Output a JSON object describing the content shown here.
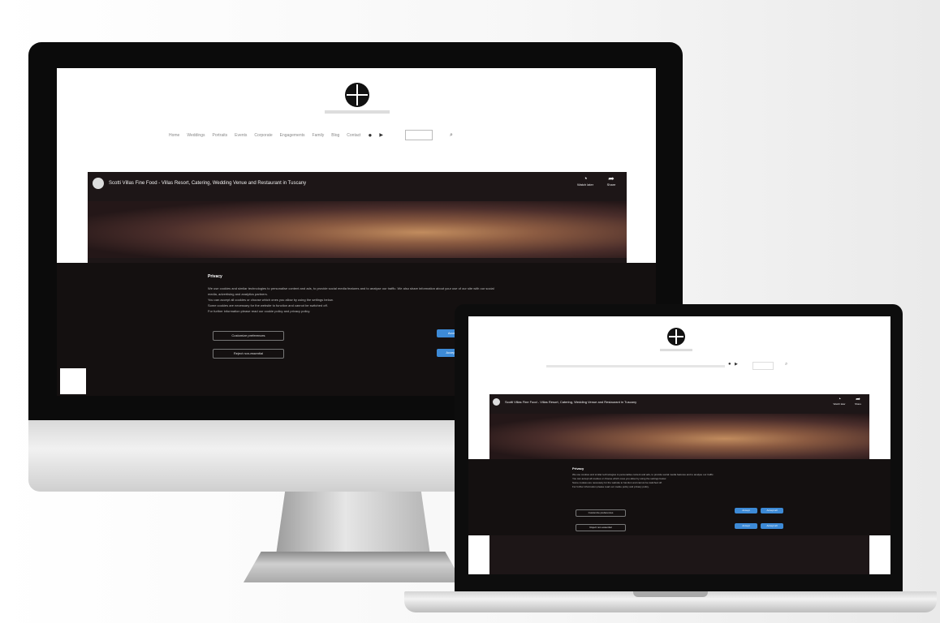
{
  "imac": {
    "nav_items": [
      "Home",
      "Weddings",
      "Portraits",
      "Events",
      "Corporate",
      "Engagements",
      "Family",
      "Blog",
      "Contact"
    ],
    "video_title": "Scotti Villas Fine Food - Villas Resort, Catering, Wedding Venue and Restaurant in Tuscany",
    "watch_later_label": "Watch later",
    "share_label": "Share",
    "consent": {
      "title": "Privacy",
      "paragraphs": [
        "We use cookies and similar technologies to personalise content and ads, to provide social media features and to analyse our traffic. We also share information about your use of our site with our social media, advertising and analytics partners.",
        "You can accept all cookies or choose which ones you allow by using the settings below.",
        "Some cookies are necessary for the website to function and cannot be switched off.",
        "For further information please read our cookie policy and privacy policy."
      ],
      "btn_customize": "Customize preferences",
      "btn_reject": "Reject non-essential",
      "btn_accept": "Accept",
      "btn_accept_all": "Accept all"
    }
  },
  "laptop": {
    "video_title": "Scotti Villas Fine Food - Villas Resort, Catering, Wedding Venue and Restaurant in Tuscany",
    "watch_later_label": "Watch later",
    "share_label": "Share",
    "consent": {
      "title": "Privacy",
      "paragraphs": [
        "We use cookies and similar technologies to personalise content and ads, to provide social media features and to analyse our traffic.",
        "You can accept all cookies or choose which ones you allow by using the settings below.",
        "Some cookies are necessary for the website to function and cannot be switched off.",
        "For further information please read our cookie policy and privacy policy."
      ],
      "btn_customize": "Customize preferences",
      "btn_reject": "Reject non-essential",
      "btn_accept": "Accept",
      "btn_accept_all": "Accept all"
    }
  },
  "colors": {
    "accent_button": "#3d8ad6",
    "video_background": "#1d1617",
    "consent_background": "#141010"
  },
  "icons": [
    "logo-icon",
    "channel-icon",
    "clock-icon",
    "share-icon",
    "user-icon",
    "search-icon"
  ]
}
